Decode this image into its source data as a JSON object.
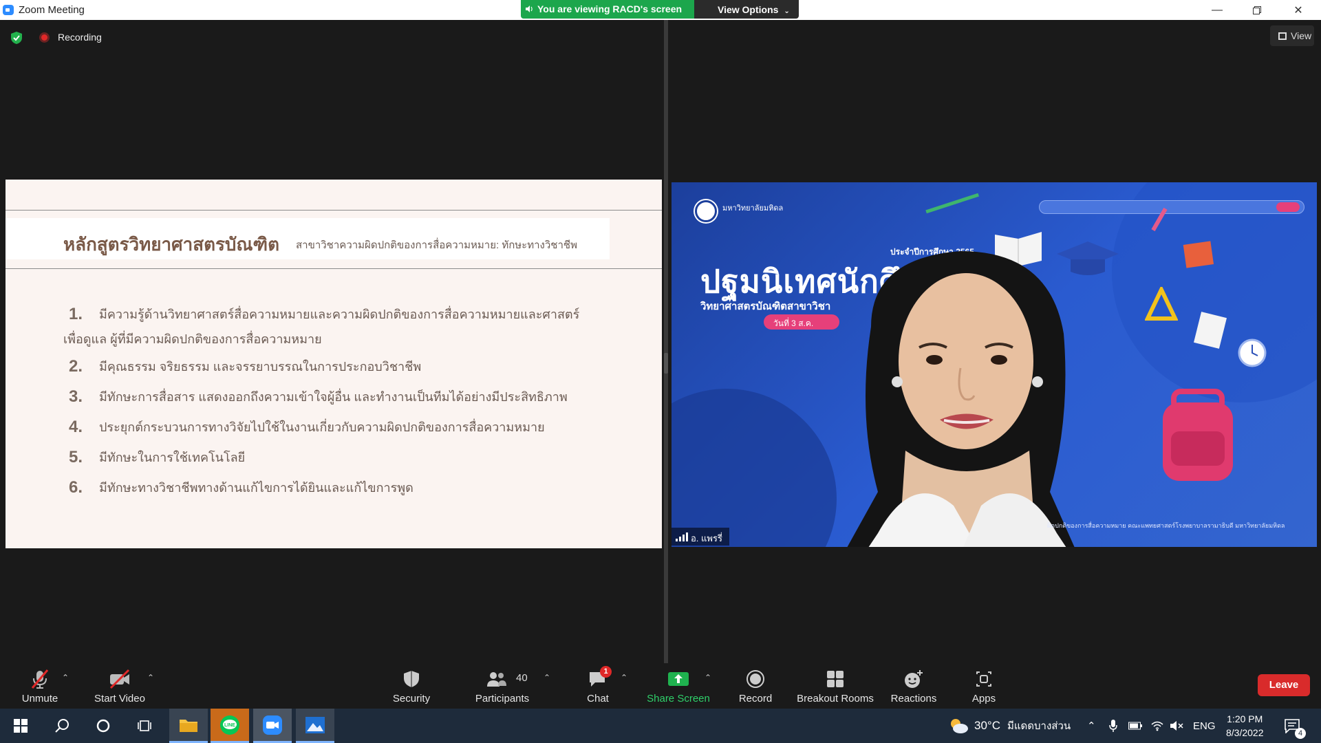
{
  "window": {
    "title": "Zoom Meeting",
    "viewing_banner": "You are viewing RACD's screen",
    "view_options": "View Options"
  },
  "meeting": {
    "recording_label": "Recording",
    "view_label": "View"
  },
  "slide": {
    "title_main": "หลักสูตรวิทยาศาสตรบัณฑิต",
    "title_sub": "สาขาวิชาความผิดปกติของการสื่อความหมาย: ทักษะทางวิชาชีพ",
    "items": [
      {
        "num": "1.",
        "text": "มีความรู้ด้านวิทยาศาสตร์สื่อความหมายและความผิดปกติของการสื่อความหมายและศาสตร์",
        "cont": "เพื่อดูแล ผู้ที่มีความผิดปกติของการสื่อความหมาย"
      },
      {
        "num": "2.",
        "text": "มีคุณธรรม จริยธรรม และจรรยาบรรณในการประกอบวิชาชีพ"
      },
      {
        "num": "3.",
        "text": "มีทักษะการสื่อสาร แสดงออกถึงความเข้าใจผู้อื่น และทำงานเป็นทีมได้อย่างมีประสิทธิภาพ"
      },
      {
        "num": "4.",
        "text": "ประยุกต์กระบวนการทางวิจัยไปใช้ในงานเกี่ยวกับความผิดปกติของการสื่อความหมาย"
      },
      {
        "num": "5.",
        "text": "มีทักษะในการใช้เทคโนโลยี"
      },
      {
        "num": "6.",
        "text": "มีทักษะทางวิชาชีพทางด้านแก้ไขการได้ยินและแก้ไขการพูด"
      }
    ]
  },
  "video": {
    "university": "มหาวิทยาลัยมหิดล",
    "year_label": "ประจำปีการศึกษา 2565",
    "big_title": "ปฐมนิเทศนักศึกษา",
    "sub_title": "วิทยาศาสตรบัณฑิตสาขาวิชา",
    "date_label": "วันที่ 3 ส.ค.",
    "participant_name": "อ. แพรรี่"
  },
  "toolbar": {
    "unmute": "Unmute",
    "start_video": "Start Video",
    "security": "Security",
    "participants": "Participants",
    "participants_count": "40",
    "chat": "Chat",
    "chat_badge": "1",
    "share_screen": "Share Screen",
    "record": "Record",
    "breakout_rooms": "Breakout Rooms",
    "reactions": "Reactions",
    "apps": "Apps",
    "leave": "Leave"
  },
  "taskbar": {
    "weather_temp": "30°C",
    "weather_text": "มีแดดบางส่วน",
    "language": "ENG",
    "time": "1:20 PM",
    "date": "8/3/2022",
    "notification_count": "4"
  },
  "colors": {
    "zoom_blue": "#2d8cff",
    "share_green": "#1ca64c",
    "leave_red": "#d92b2b",
    "slide_bg": "#fbf4f1"
  }
}
